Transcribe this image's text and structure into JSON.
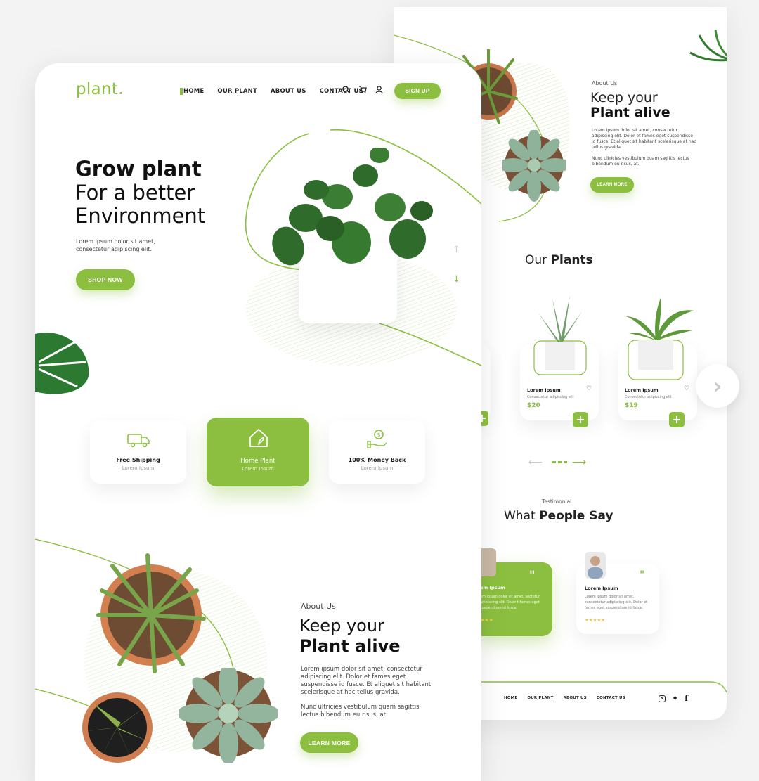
{
  "brand": {
    "logo": "plant.",
    "accent": "#8cbf3f"
  },
  "nav": {
    "items": [
      "HOME",
      "OUR PLANT",
      "ABOUT US",
      "CONTACT US"
    ],
    "signup": "SIGN UP"
  },
  "hero": {
    "title_bold": "Grow plant",
    "title_line2": "For a better",
    "title_line3": "Environment",
    "text": "Lorem ipsum dolor sit amet, consectetur adipiscing elit.",
    "cta": "SHOP NOW"
  },
  "features": [
    {
      "title": "Free Shipping",
      "sub": "Lorem Ipsum",
      "icon": "truck-icon"
    },
    {
      "title": "Home Plant",
      "sub": "Lorem Ipsum",
      "icon": "house-plant-icon"
    },
    {
      "title": "100% Money Back",
      "sub": "Lorem Ipsum",
      "icon": "money-hand-icon"
    }
  ],
  "about": {
    "eyebrow": "About Us",
    "title_line1": "Keep your",
    "title_line2": "Plant alive",
    "para1": "Lorem ipsum dolor sit amet, consectetur adipiscing elit. Dolor et fames eget suspendisse id fusce. Et aliquet sit habitant scelerisque at hac tellus gravida.",
    "para2": "Nunc ultricies vestibulum quam sagittis lectus bibendum eu risus, at.",
    "cta": "LEARN MORE"
  },
  "plants_section": {
    "title_light": "Our",
    "title_bold": "Plants",
    "products": [
      {
        "name": "Lorem Ipsum",
        "desc": "Consectetur adipiscing elit",
        "price": "$20"
      },
      {
        "name": "Lorem Ipsum",
        "desc": "Consectetur adipiscing elit",
        "price": "$19"
      }
    ]
  },
  "testimonial": {
    "eyebrow": "Testimonial",
    "title_light": "What",
    "title_bold": "People Say",
    "cards": [
      {
        "name": "em Ipsum",
        "text": "em ipsum dolor sit amet, sectetur adipiscing elit. Dolor t fames eget suspendisse id fusce.",
        "stars": "★★★"
      },
      {
        "name": "Lorem Ipsum",
        "text": "Lorem ipsum dolor sit amet, consectetur adipiscing elit. Dolor et fames eget suspendisse id fusce.",
        "stars": "★★★★★"
      }
    ]
  },
  "footer": {
    "items": [
      "HOME",
      "OUR PLANT",
      "ABOUT US",
      "CONTACT US"
    ],
    "social": [
      "instagram-icon",
      "twitter-icon",
      "facebook-icon"
    ]
  }
}
